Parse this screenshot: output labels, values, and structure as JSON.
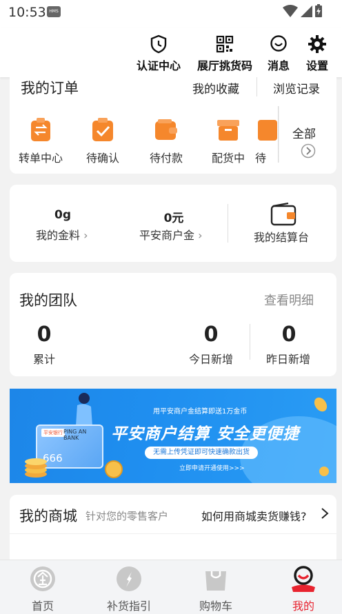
{
  "status_bar": {
    "time": "10:53",
    "hms_badge": "HMS"
  },
  "topbar": {
    "items": [
      {
        "label": "认证中心",
        "icon": "shield-clock-icon"
      },
      {
        "label": "展厅挑货码",
        "icon": "qr-code-icon"
      },
      {
        "label": "消息",
        "icon": "message-smile-icon"
      },
      {
        "label": "设置",
        "icon": "gear-icon"
      }
    ]
  },
  "orders": {
    "title": "我的订单",
    "favorites": "我的收藏",
    "history": "浏览记录",
    "items": [
      {
        "label": "转单中心",
        "icon": "transfer-doc-icon"
      },
      {
        "label": "待确认",
        "icon": "clipboard-check-icon"
      },
      {
        "label": "待付款",
        "icon": "wallet-icon"
      },
      {
        "label": "配货中",
        "icon": "box-icon"
      },
      {
        "label": "待",
        "icon": "doc-icon"
      }
    ],
    "all_label": "全部"
  },
  "assets": {
    "gold_value": "0g",
    "gold_label": "我的金料",
    "merchant_value": "0元",
    "merchant_label": "平安商户金",
    "checkout_label": "我的结算台"
  },
  "team": {
    "title": "我的团队",
    "detail_link": "查看明细",
    "stats": [
      {
        "value": "0",
        "label": "累计"
      },
      {
        "value": "0",
        "label": "今日新增"
      },
      {
        "value": "0",
        "label": "昨日新增"
      }
    ]
  },
  "banner": {
    "top_text": "用平安商户金结算即送1万金币",
    "main_text": "平安商户结算 安全更便捷",
    "pill_text": "无需上传凭证即可快速确款出货",
    "link_text": "立即申请开通使用>>>",
    "card_bank": "平安银行",
    "card_name": "PING AN BANK",
    "card_number": "666"
  },
  "mall": {
    "title": "我的商城",
    "subtitle": "针对您的零售客户",
    "help_link": "如何用商城卖货赚钱?"
  },
  "tabbar": {
    "tabs": [
      {
        "label": "首页",
        "icon": "home-gold-icon"
      },
      {
        "label": "补货指引",
        "icon": "compass-icon"
      },
      {
        "label": "购物车",
        "icon": "shopping-bag-icon"
      },
      {
        "label": "我的",
        "icon": "profile-icon"
      }
    ],
    "active_index": 3
  },
  "colors": {
    "accent": "#e8232f",
    "order_icon": "#f5872c",
    "banner_blue": "#1d86e8"
  }
}
